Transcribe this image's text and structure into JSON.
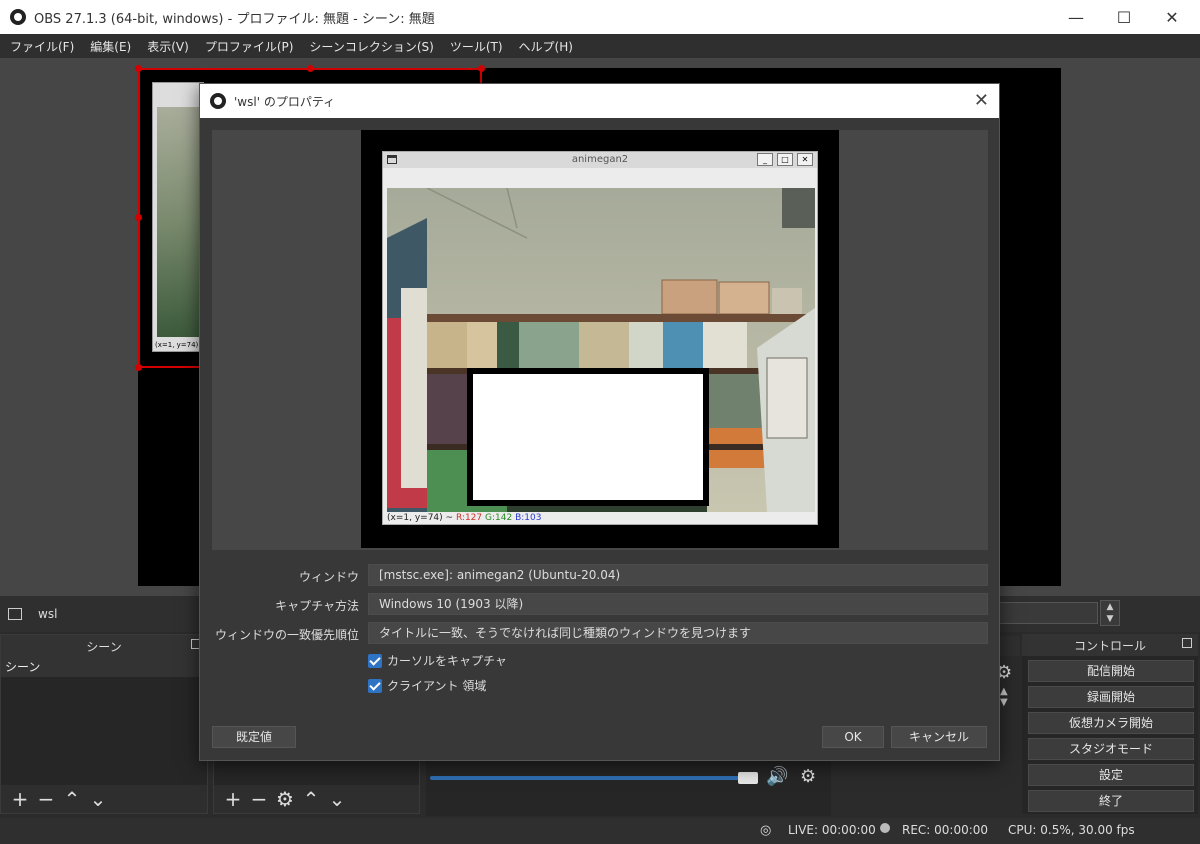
{
  "window": {
    "title": "OBS 27.1.3 (64-bit, windows) - プロファイル: 無題 - シーン: 無題"
  },
  "menu": [
    "ファイル(F)",
    "編集(E)",
    "表示(V)",
    "プロファイル(P)",
    "シーンコレクション(S)",
    "ツール(T)",
    "ヘルプ(H)"
  ],
  "preview": {
    "mini_status": "(x=1, y=74) ~"
  },
  "source_bar": {
    "source_name": "wsl"
  },
  "scenes": {
    "header": "シーン",
    "items": [
      "シーン"
    ]
  },
  "controls": {
    "header": "コントロール",
    "buttons": [
      "配信開始",
      "録画開始",
      "仮想カメラ開始",
      "スタジオモード",
      "設定",
      "終了"
    ]
  },
  "status": {
    "live": "LIVE: 00:00:00",
    "rec": "REC: 00:00:00",
    "cpu": "CPU: 0.5%, 30.00 fps"
  },
  "dialog": {
    "title": "'wsl' のプロパティ",
    "captured_window": {
      "title": "animegan2",
      "status_prefix": "(x=1, y=74) ~",
      "r": "R:127",
      "g": "G:142",
      "b": "B:103"
    },
    "fields": [
      {
        "label": "ウィンドウ",
        "value": "[mstsc.exe]: animegan2 (Ubuntu-20.04)"
      },
      {
        "label": "キャプチャ方法",
        "value": "Windows 10 (1903 以降)"
      },
      {
        "label": "ウィンドウの一致優先順位",
        "value": "タイトルに一致、そうでなければ同じ種類のウィンドウを見つけます"
      }
    ],
    "checks": [
      {
        "label": "カーソルをキャプチャ",
        "checked": true
      },
      {
        "label": "クライアント 領域",
        "checked": true
      }
    ],
    "defaults_button": "既定値",
    "ok_button": "OK",
    "cancel_button": "キャンセル"
  }
}
